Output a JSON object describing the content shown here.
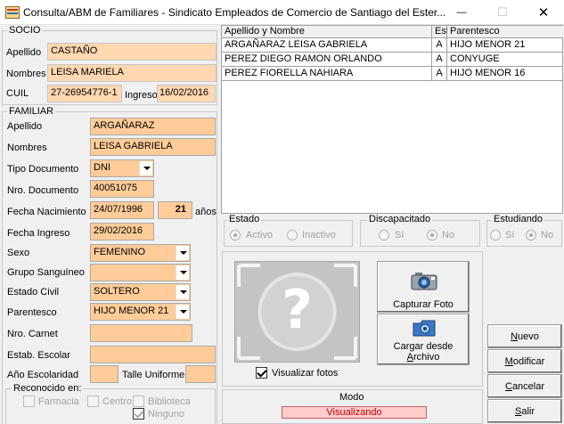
{
  "window": {
    "title": "Consulta/ABM de Familiares - Sindicato Empleados de Comercio de Santiago del Ester...",
    "minimize_glyph": "—",
    "maximize_glyph": "☐",
    "close_glyph": "✕"
  },
  "socio": {
    "group_label": "SOCIO",
    "apellido_label": "Apellido",
    "apellido": "CASTAÑO",
    "nombres_label": "Nombres",
    "nombres": "LEISA MARIELA",
    "cuil_label": "CUIL",
    "cuil": "27-26954776-1",
    "ingreso_label": "Ingreso",
    "ingreso": "16/02/2016"
  },
  "familiar": {
    "group_label": "FAMILIAR",
    "apellido_label": "Apellido",
    "apellido": "ARGAÑARAZ",
    "nombres_label": "Nombres",
    "nombres": "LEISA GABRIELA",
    "tipo_doc_label": "Tipo Documento",
    "tipo_doc": "DNI",
    "nro_doc_label": "Nro. Documento",
    "nro_doc": "40051075",
    "fecha_nac_label": "Fecha Nacimiento",
    "fecha_nac": "24/07/1996",
    "edad": "21",
    "anios_label": "años",
    "fecha_ingreso_label": "Fecha Ingreso",
    "fecha_ingreso": "29/02/2016",
    "sexo_label": "Sexo",
    "sexo": "FEMENINO",
    "grupo_sang_label": "Grupo Sanguíneo",
    "grupo_sang": "",
    "estado_civil_label": "Estado Civil",
    "estado_civil": "SOLTERO",
    "parentesco_label": "Parentesco",
    "parentesco": "HIJO MENOR 21",
    "nro_carnet_label": "Nro. Carnet",
    "nro_carnet": "",
    "estab_escolar_label": "Estab. Escolar",
    "estab_escolar": "",
    "anio_escolaridad_label": "Año Escolaridad",
    "anio_escolaridad": "",
    "talle_uniforme_label": "Talle Uniforme",
    "talle_uniforme": "",
    "reconocido_label": "Reconocido en:",
    "reconocido": [
      {
        "label": "Farmacia",
        "checked": false
      },
      {
        "label": "Centro",
        "checked": false
      },
      {
        "label": "Biblioteca",
        "checked": false
      },
      {
        "label": "Ninguno",
        "checked": true
      }
    ]
  },
  "grid": {
    "columns": [
      "Apellido y Nombre",
      "Est",
      "Parentesco"
    ],
    "rows": [
      [
        "ARGAÑARAZ LEISA GABRIELA",
        "A",
        "HIJO MENOR 21"
      ],
      [
        "PEREZ DIEGO RAMON ORLANDO",
        "A",
        "CONYUGE"
      ],
      [
        "PEREZ FIORELLA NAHIARA",
        "A",
        "HIJO MENOR 16"
      ]
    ]
  },
  "estado": {
    "label": "Estado",
    "options": [
      "Activo",
      "Inactivo"
    ],
    "selected": "Activo"
  },
  "discapacitado": {
    "label": "Discapacitado",
    "options": [
      "Sí",
      "No"
    ],
    "selected": "No"
  },
  "estudiando": {
    "label": "Estudiando",
    "options": [
      "Sí",
      "No"
    ],
    "selected": "No"
  },
  "photo": {
    "placeholder_glyph": "?",
    "capturar_label": "Capturar Foto",
    "cargar_label_1": "Cargar desde",
    "cargar_label_2": "Archivo",
    "visualizar_label": "Visualizar fotos",
    "visualizar_checked": true
  },
  "modo": {
    "label": "Modo",
    "value": "Visualizando"
  },
  "actions": {
    "nuevo_underline": "N",
    "nuevo_rest": "uevo",
    "modificar_underline": "M",
    "modificar_rest": "odificar",
    "cancelar_underline": "C",
    "cancelar_rest": "ancelar",
    "salir_underline": "S",
    "salir_rest": "alir"
  },
  "colors": {
    "field_bg": "#ffcc99",
    "modo_bg": "#ffcccc",
    "modo_text": "#c00000",
    "window_bg": "#f0f0f0"
  }
}
